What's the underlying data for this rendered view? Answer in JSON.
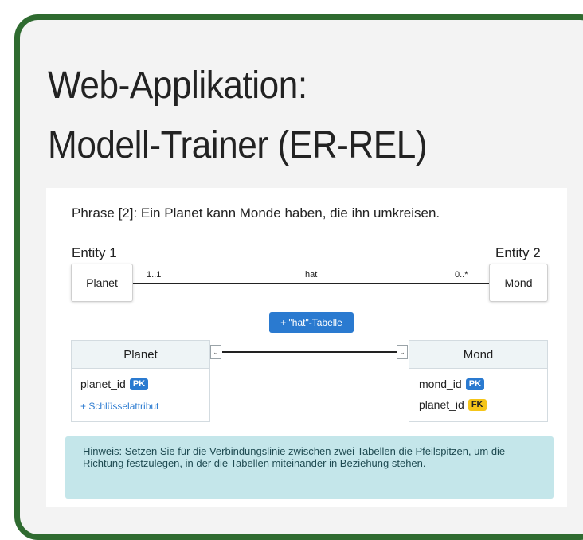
{
  "header": {
    "title_line1": "Web-Applikation:",
    "title_line2": "Modell-Trainer (ER-REL)"
  },
  "phrase": "Phrase [2]: Ein Planet kann Monde haben, die ihn umkreisen.",
  "relationship": {
    "entity1_label": "Entity 1",
    "entity2_label": "Entity 2",
    "entity1_name": "Planet",
    "entity2_name": "Mond",
    "cardinality_left": "1..1",
    "cardinality_right": "0..*",
    "relation_name": "hat",
    "add_table_button": "+ \"hat\"-Tabelle"
  },
  "tables": {
    "left": {
      "name": "Planet",
      "attributes": [
        {
          "name": "planet_id",
          "badge": "PK"
        }
      ],
      "add_key_link": "+ Schlüsselattribut"
    },
    "right": {
      "name": "Mond",
      "attributes": [
        {
          "name": "mond_id",
          "badge": "PK"
        },
        {
          "name": "planet_id",
          "badge": "FK"
        }
      ]
    },
    "arrow_selectors": [
      "⌄",
      "⌄"
    ]
  },
  "hint": "Hinweis: Setzen Sie für die Verbindungslinie zwischen zwei Tabellen die Pfeilspitzen, um die Richtung festzulegen, in der die Tabellen miteinander in Beziehung stehen.",
  "colors": {
    "frame": "#2f6b30",
    "accent": "#2a7ad0",
    "pk_badge": "#2a7ad0",
    "fk_badge": "#f5c518",
    "hint_bg": "#c4e6ea"
  }
}
